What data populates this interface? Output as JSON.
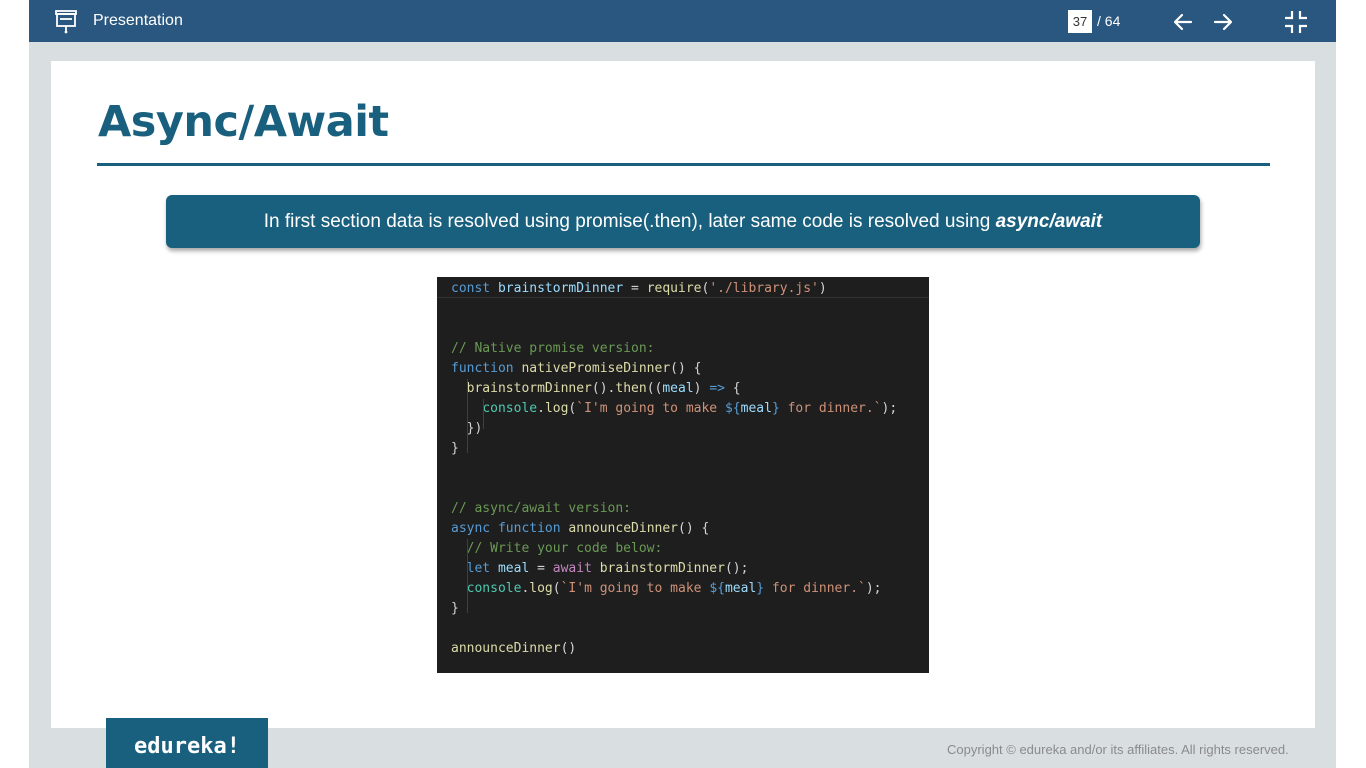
{
  "topbar": {
    "title": "Presentation",
    "current_page": "37",
    "total_pages": "/ 64",
    "icons": [
      "presentation-icon",
      "arrow-left-icon",
      "arrow-right-icon",
      "exit-fullscreen-icon"
    ]
  },
  "slide": {
    "title": "Async/Await",
    "banner_text": "In first section data is resolved using promise(.then), later same code is resolved using ",
    "banner_emphasis": "async/await",
    "code_lines": [
      "const brainstormDinner = require('./library.js')",
      "",
      "",
      "// Native promise version:",
      "function nativePromiseDinner() {",
      "  brainstormDinner().then((meal) => {",
      "    console.log(`I'm going to make ${meal} for dinner.`);",
      "  })",
      "}",
      "",
      "",
      "// async/await version:",
      "async function announceDinner() {",
      "  // Write your code below:",
      "  let meal = await brainstormDinner();",
      "  console.log(`I'm going to make ${meal} for dinner.`);",
      "}",
      "",
      "announceDinner()"
    ]
  },
  "footer": {
    "logo_text": "edureka!",
    "copyright": "Copyright © edureka and/or its affiliates. All rights reserved."
  },
  "colors": {
    "topbar": "#29577f",
    "accent": "#19607f",
    "code_bg": "#1e1e1e",
    "frame": "#d9dfe1"
  }
}
